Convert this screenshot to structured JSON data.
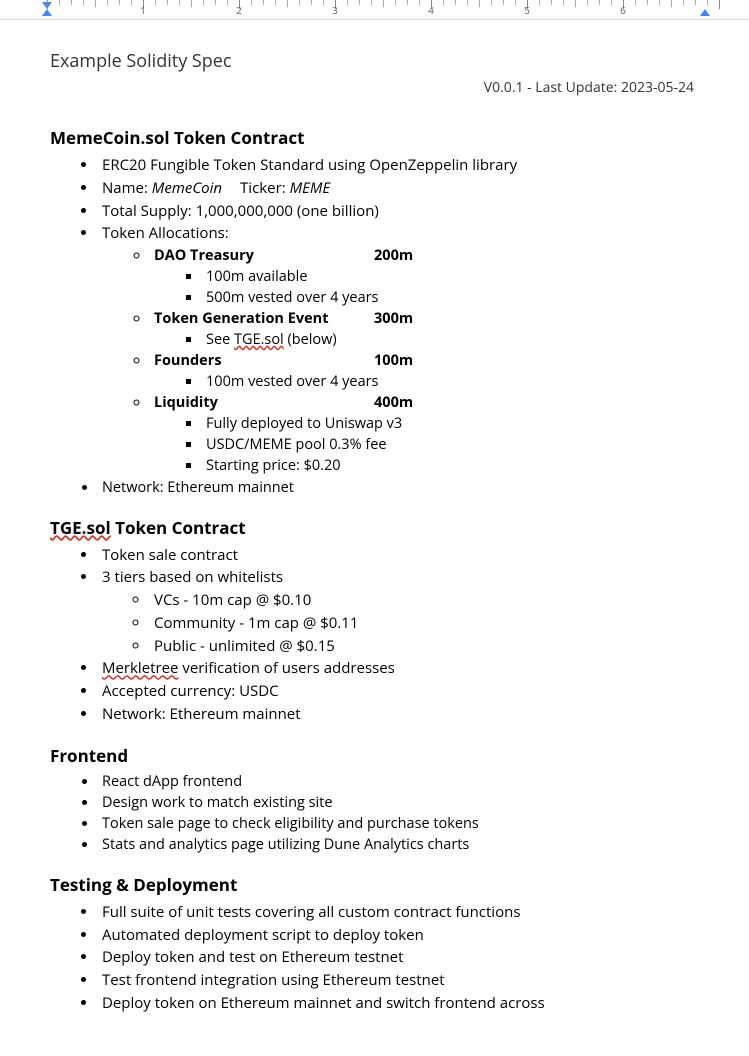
{
  "ruler": {
    "numbers": [
      "1",
      "2",
      "3",
      "4",
      "5",
      "6"
    ]
  },
  "doc": {
    "title": "Example Solidity Spec",
    "version": "V0.0.1 - Last Update: 2023-05-24"
  },
  "section1": {
    "heading": "MemeCoin.sol Token Contract",
    "b1": "ERC20 Fungible Token Standard using OpenZeppelin library",
    "b2_prefix": "Name: ",
    "b2_name": "MemeCoin",
    "b2_mid": "Ticker: ",
    "b2_ticker": "MEME",
    "b3": "Total Supply: 1,000,000,000 (one billion)",
    "b4": "Token Allocations:",
    "alloc": {
      "dao": {
        "name": "DAO Treasury",
        "amt": "200m",
        "s1": "100m available",
        "s2": "500m vested over 4 years"
      },
      "tge": {
        "name": "Token Generation Event",
        "amt": "300m",
        "see_prefix": "See ",
        "see_link": "TGE.sol",
        "see_suffix": " (below)"
      },
      "founders": {
        "name": "Founders",
        "amt": "100m",
        "s1": "100m vested over 4 years"
      },
      "liq": {
        "name": "Liquidity",
        "amt": "400m",
        "s1": "Fully deployed to Uniswap v3",
        "s2": "USDC/MEME pool 0.3% fee",
        "s3": "Starting price: $0.20"
      }
    },
    "b5": "Network: Ethereum mainnet"
  },
  "section2": {
    "heading_link": "TGE.sol",
    "heading_rest": " Token Contract",
    "b1": "Token sale contract",
    "b2": "3 tiers based on whitelists",
    "tiers": {
      "t1": "VCs - 10m cap @ $0.10",
      "t2": "Community - 1m cap @ $0.11",
      "t3": "Public - unlimited @ $0.15"
    },
    "b3_link": "Merkletree",
    "b3_rest": " verification of users addresses",
    "b4": "Accepted currency: USDC",
    "b5": "Network: Ethereum mainnet"
  },
  "section3": {
    "heading": "Frontend",
    "b1": "React dApp frontend",
    "b2": "Design work to match existing site",
    "b3": "Token sale page to check eligibility and purchase tokens",
    "b4": "Stats and analytics page utilizing Dune Analytics charts"
  },
  "section4": {
    "heading": "Testing & Deployment",
    "b1": "Full suite of unit tests covering all custom contract functions",
    "b2": "Automated deployment script to deploy token",
    "b3": "Deploy token and test on Ethereum testnet",
    "b4": "Test frontend integration using Ethereum testnet",
    "b5": "Deploy token on Ethereum mainnet and switch frontend across"
  }
}
